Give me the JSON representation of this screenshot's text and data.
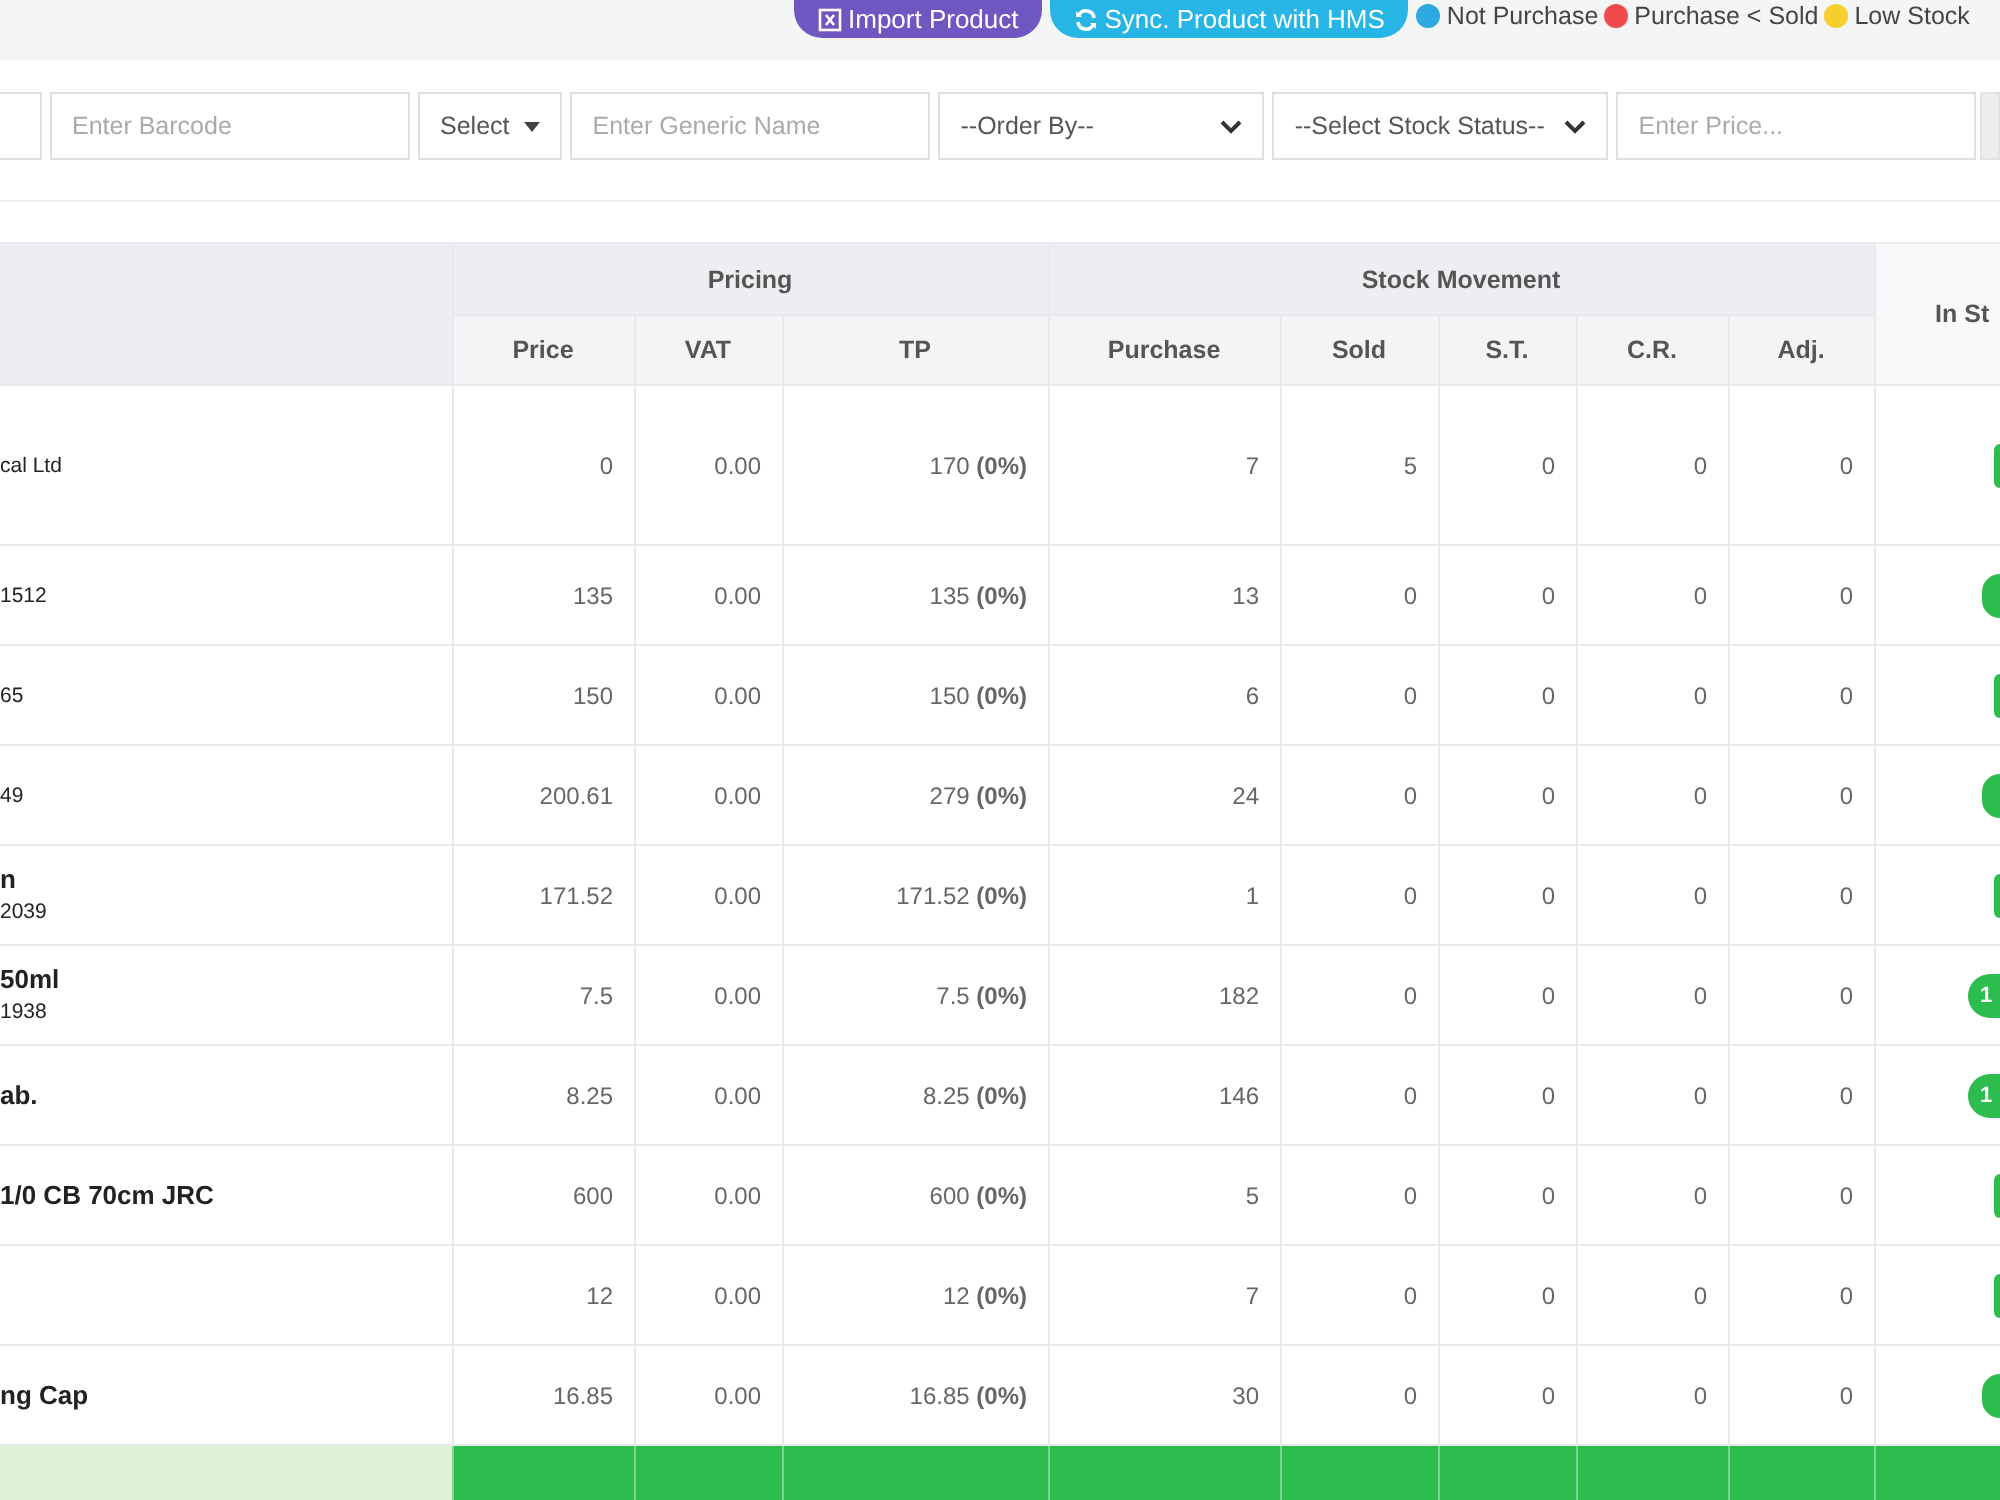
{
  "toolbar": {
    "buttons": [
      {
        "kind": "import",
        "label": "Import Product"
      },
      {
        "kind": "sync",
        "label": "Sync. Product with HMS"
      }
    ],
    "legend": [
      {
        "label": "Not Purchase",
        "color": "#2ea8e0"
      },
      {
        "label": "Purchase < Sold",
        "color": "#f04a4a"
      },
      {
        "label": "Low Stock",
        "color": "#f5cf2d"
      }
    ]
  },
  "filters": {
    "barcode": {
      "placeholder": "Enter Barcode"
    },
    "select": "Select",
    "generic": {
      "placeholder": "Enter Generic Name"
    },
    "order_by": "--Order By--",
    "stock_status": "--Select Stock Status--",
    "price": {
      "placeholder": "Enter Price..."
    }
  },
  "table": {
    "groups": [
      "Pricing",
      "Stock Movement"
    ],
    "columns": [
      "Price",
      "VAT",
      "TP",
      "Purchase",
      "Sold",
      "S.T.",
      "C.R.",
      "Adj."
    ],
    "stock_column": "In St",
    "rows": [
      {
        "sub": "cal Ltd",
        "price": "0",
        "vat": "0.00",
        "tp": "170 **(0%)**",
        "purchase": "7",
        "sold": "5",
        "st": "0",
        "cr": "0",
        "adj": "0",
        "kind": "thin"
      },
      {
        "sub": "1512",
        "price": "135",
        "vat": "0.00",
        "tp": "135 **(0%)**",
        "purchase": "13",
        "sold": "0",
        "st": "0",
        "cr": "0",
        "adj": "0",
        "kind": "wide"
      },
      {
        "sub": "65",
        "price": "150",
        "vat": "0.00",
        "tp": "150 **(0%)**",
        "purchase": "6",
        "sold": "0",
        "st": "0",
        "cr": "0",
        "adj": "0",
        "kind": "thin"
      },
      {
        "sub": "49",
        "price": "200.61",
        "vat": "0.00",
        "tp": "279 **(0%)**",
        "purchase": "24",
        "sold": "0",
        "st": "0",
        "cr": "0",
        "adj": "0",
        "kind": "wide"
      },
      {
        "name": "n",
        "sub": "2039",
        "price": "171.52",
        "vat": "0.00",
        "tp": "171.52 **(0%)**",
        "purchase": "1",
        "sold": "0",
        "st": "0",
        "cr": "0",
        "adj": "0",
        "kind": "thin"
      },
      {
        "name": "50ml",
        "sub": "1938",
        "price": "7.5",
        "vat": "0.00",
        "tp": "7.5 **(0%)**",
        "purchase": "182",
        "sold": "0",
        "st": "0",
        "cr": "0",
        "adj": "0",
        "kind": "text",
        "stock": "1"
      },
      {
        "name": "ab.",
        "price": "8.25",
        "vat": "0.00",
        "tp": "8.25 **(0%)**",
        "purchase": "146",
        "sold": "0",
        "st": "0",
        "cr": "0",
        "adj": "0",
        "kind": "text",
        "stock": "1"
      },
      {
        "name": "1/0 CB 70cm JRC",
        "price": "600",
        "vat": "0.00",
        "tp": "600 **(0%)**",
        "purchase": "5",
        "sold": "0",
        "st": "0",
        "cr": "0",
        "adj": "0",
        "kind": "thin"
      },
      {
        "price": "12",
        "vat": "0.00",
        "tp": "12 **(0%)**",
        "purchase": "7",
        "sold": "0",
        "st": "0",
        "cr": "0",
        "adj": "0",
        "kind": "thin"
      },
      {
        "name": "ng Cap",
        "price": "16.85",
        "vat": "0.00",
        "tp": "16.85 **(0%)**",
        "purchase": "30",
        "sold": "0",
        "st": "0",
        "cr": "0",
        "adj": "0",
        "kind": "wide"
      }
    ]
  }
}
